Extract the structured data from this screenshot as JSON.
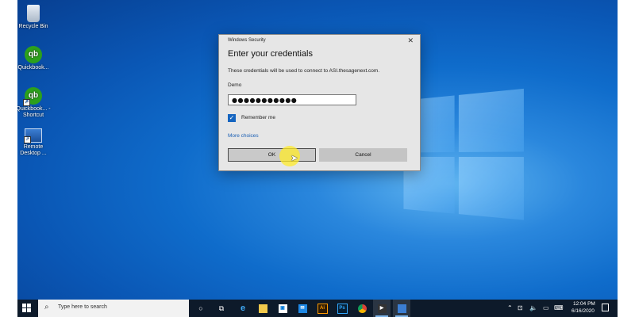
{
  "desktop": {
    "icons": [
      {
        "label": "Recycle Bin",
        "icon": "recycle-bin-icon"
      },
      {
        "label": "Quickbook...",
        "icon": "quickbooks-icon"
      },
      {
        "label": "Quickbook... - Shortcut",
        "icon": "quickbooks-shortcut-icon"
      },
      {
        "label": "Remote Desktop ...",
        "icon": "remote-desktop-icon"
      }
    ]
  },
  "dialog": {
    "window_title": "Windows Security",
    "heading": "Enter your credentials",
    "description": "These credentials will be used to connect to ASI.thesagenext.com.",
    "username": "Demo",
    "password_masked": "●●●●●●●●●●●",
    "remember_checked": true,
    "remember_label": "Remember me",
    "more_choices": "More choices",
    "ok_label": "OK",
    "cancel_label": "Cancel",
    "close_glyph": "✕"
  },
  "taskbar": {
    "search_placeholder": "Type here to search",
    "apps": [
      "task-view",
      "file-explorer",
      "edge",
      "file-manager",
      "store",
      "mail",
      "illustrator",
      "photoshop",
      "chrome",
      "media-player",
      "remote-desktop"
    ],
    "clock_time": "12:04 PM",
    "clock_date": "6/16/2020"
  },
  "colors": {
    "accent": "#1565c0",
    "wallpaper": "#0a56b4",
    "taskbar": "#0d1a2a",
    "quickbooks": "#2ca01c"
  }
}
